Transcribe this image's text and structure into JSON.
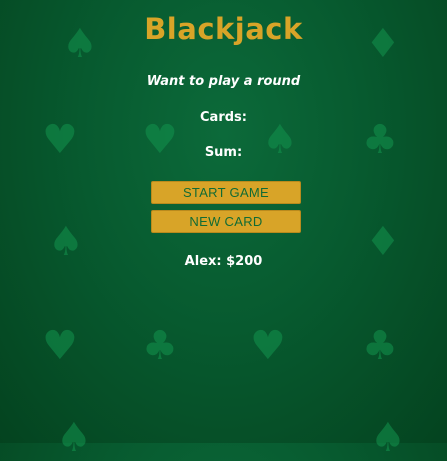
{
  "game": {
    "title": "Blackjack",
    "message": "Want to play a round",
    "cards_label": "Cards:",
    "sum_label": "Sum:",
    "start_button_label": "START GAME",
    "new_card_button_label": "NEW CARD",
    "player_info": "Alex: $200"
  },
  "colors": {
    "title": "#d8a428",
    "button_bg": "#d8a428",
    "button_text": "#126b34",
    "background": "#075a2f",
    "suit_pattern": "#13944e"
  },
  "background_icons": [
    "spade-icon",
    "diamond-icon",
    "heart-icon",
    "club-icon"
  ]
}
